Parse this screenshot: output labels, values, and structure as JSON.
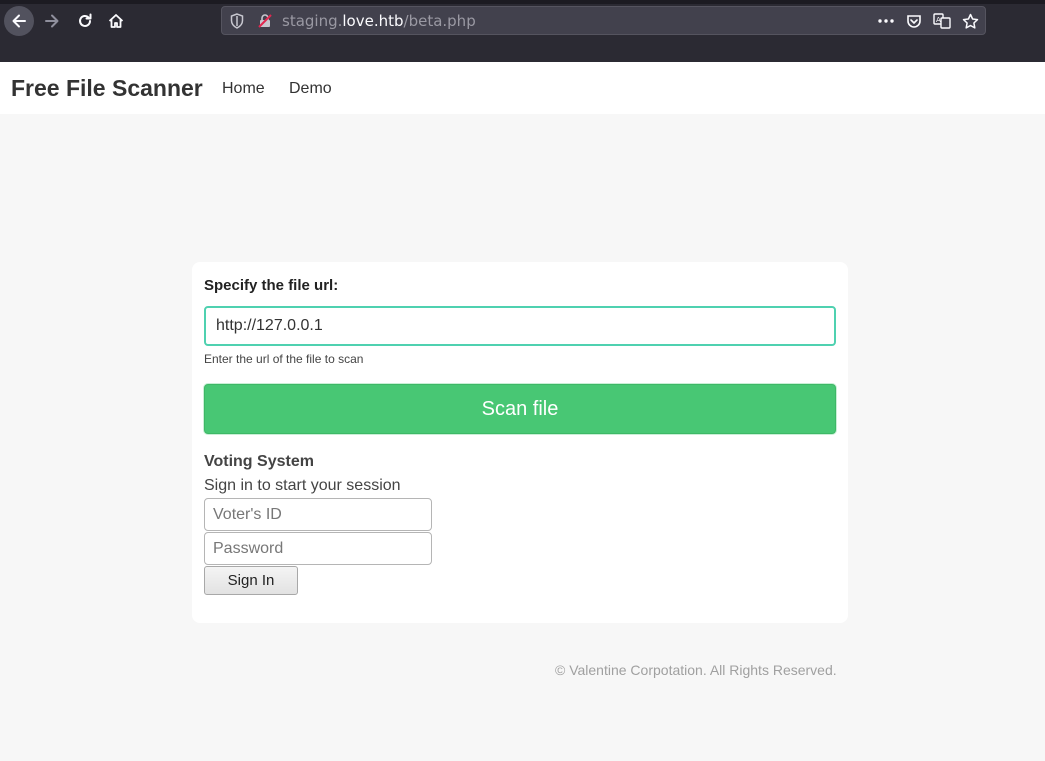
{
  "browser": {
    "url_prefix": "staging.",
    "url_host": "love.htb",
    "url_path": "/beta.php",
    "icons": [
      "back-icon",
      "forward-icon",
      "reload-icon",
      "home-icon",
      "shield-icon",
      "insecure-lock-icon",
      "more-icon",
      "pocket-icon",
      "translate-icon",
      "star-icon"
    ]
  },
  "navbar": {
    "brand": "Free File Scanner",
    "links": [
      "Home",
      "Demo"
    ]
  },
  "scanner": {
    "label": "Specify the file url:",
    "input_value": "http://127.0.0.1",
    "help": "Enter the url of the file to scan",
    "button": "Scan file"
  },
  "voting": {
    "title": "Voting System",
    "subtitle": "Sign in to start your session",
    "voter_id_placeholder": "Voter's ID",
    "password_placeholder": "Password",
    "signin": "Sign In"
  },
  "footer": "© Valentine Corpotation. All Rights Reserved.",
  "colors": {
    "accent_green": "#48c774",
    "input_border": "#4fd1b0",
    "page_bg": "#f7f7f7"
  }
}
